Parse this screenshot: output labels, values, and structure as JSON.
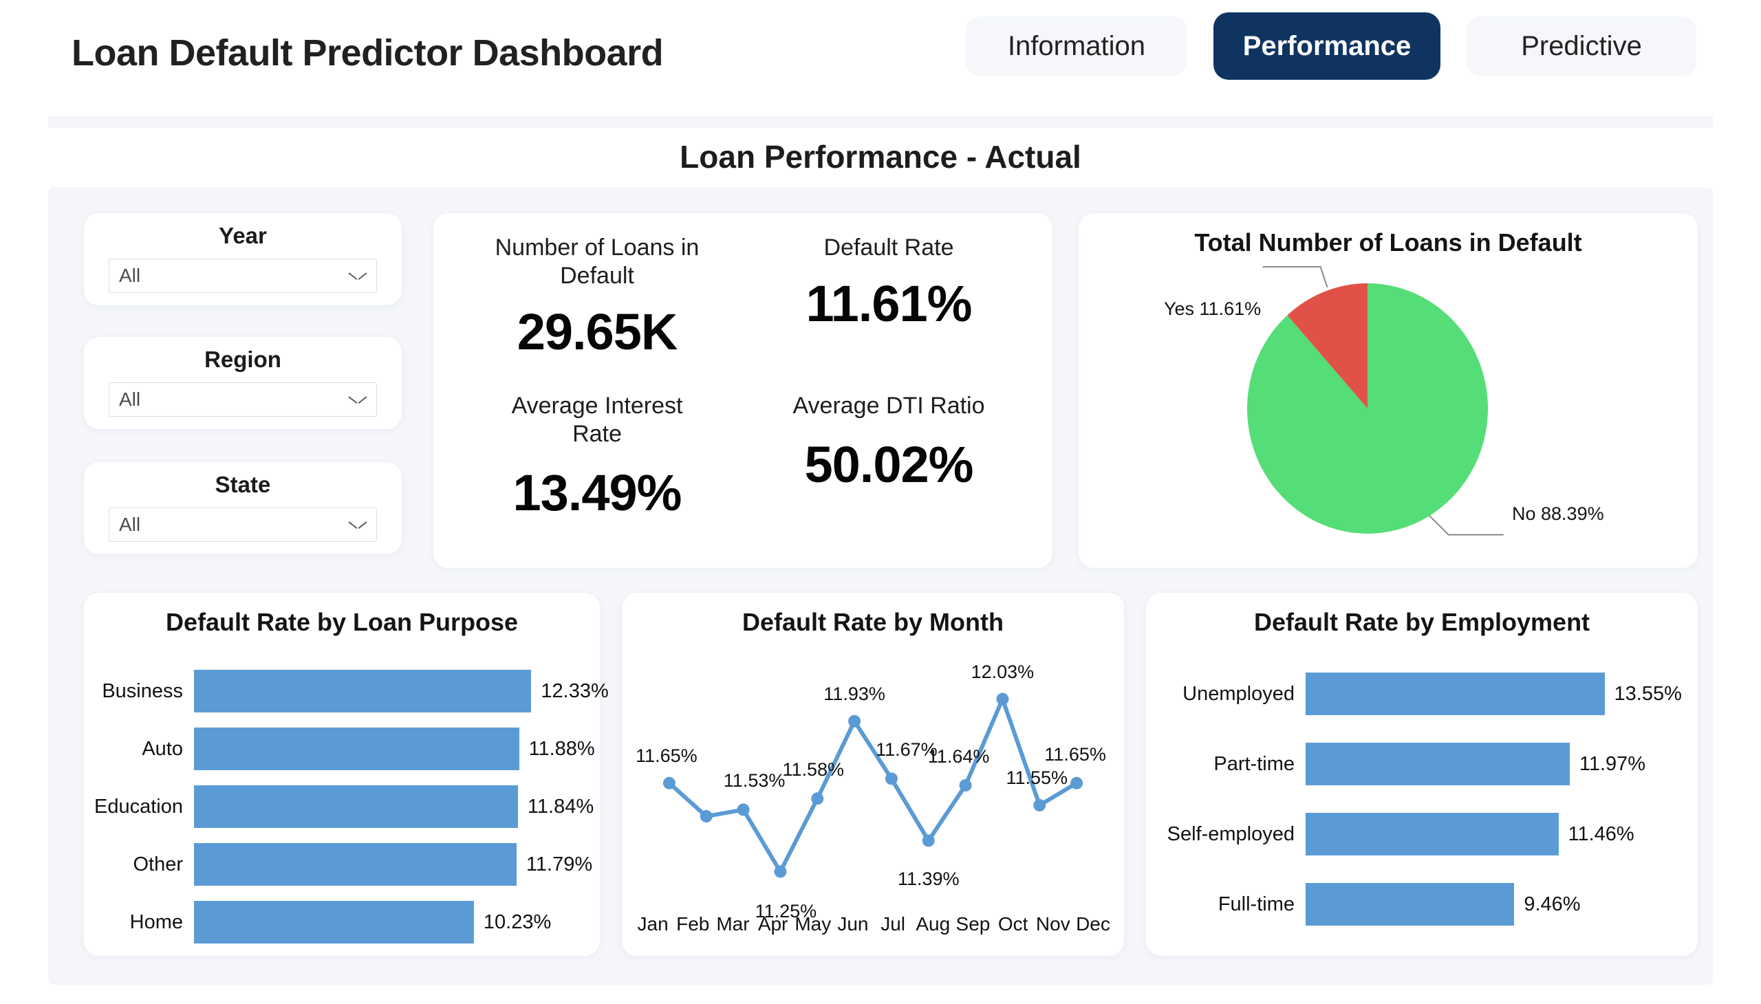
{
  "header": {
    "app_title": "Loan Default Predictor Dashboard",
    "tabs": [
      {
        "label": "Information",
        "active": false
      },
      {
        "label": "Performance",
        "active": true
      },
      {
        "label": "Predictive",
        "active": false
      }
    ],
    "section_title": "Loan Performance - Actual"
  },
  "filters": [
    {
      "label": "Year",
      "value": "All",
      "icon": "chevron-down-icon"
    },
    {
      "label": "Region",
      "value": "All",
      "icon": "chevron-down-icon"
    },
    {
      "label": "State",
      "value": "All",
      "icon": "chevron-down-icon"
    }
  ],
  "kpis": [
    {
      "label": "Number of Loans in Default",
      "value": "29.65K"
    },
    {
      "label": "Default Rate",
      "value": "11.61%"
    },
    {
      "label": "Average Interest Rate",
      "value": "13.49%"
    },
    {
      "label": "Average DTI Ratio",
      "value": "50.02%"
    }
  ],
  "colors": {
    "accent_navy": "#0f3460",
    "bar_blue": "#5b9bd5",
    "pie_green": "#55dd77",
    "pie_red": "#e05247",
    "page_bg": "#f4f6fa"
  },
  "chart_data": [
    {
      "type": "pie",
      "title": "Total Number of Loans in Default",
      "categories": [
        "Yes",
        "No"
      ],
      "values": [
        11.61,
        88.39
      ],
      "labels": [
        "Yes 11.61%",
        "No 88.39%"
      ],
      "colors": [
        "#e05247",
        "#55dd77"
      ],
      "legend": "callout-labels",
      "units": "percent"
    },
    {
      "type": "bar",
      "orientation": "horizontal",
      "title": "Default Rate by Loan Purpose",
      "categories": [
        "Business",
        "Auto",
        "Education",
        "Other",
        "Home"
      ],
      "values": [
        12.33,
        11.88,
        11.84,
        11.79,
        10.23
      ],
      "value_labels": [
        "12.33%",
        "11.88%",
        "11.84%",
        "11.79%",
        "10.23%"
      ],
      "xlabel": "",
      "ylabel": "",
      "xlim": [
        0,
        13.2
      ],
      "grid": false,
      "color": "#5b9bd5"
    },
    {
      "type": "line",
      "title": "Default Rate by Month",
      "x": [
        "Jan",
        "Feb",
        "Mar",
        "Apr",
        "May",
        "Jun",
        "Jul",
        "Aug",
        "Sep",
        "Oct",
        "Nov",
        "Dec"
      ],
      "values": [
        11.65,
        11.5,
        11.53,
        11.25,
        11.58,
        11.93,
        11.67,
        11.39,
        11.64,
        12.03,
        11.55,
        11.65
      ],
      "value_labels": [
        "11.65%",
        "",
        "11.53%",
        "11.25%",
        "11.58%",
        "11.93%",
        "11.67%",
        "11.39%",
        "11.64%",
        "12.03%",
        "11.55%",
        "11.65%"
      ],
      "ylim": [
        11.18,
        12.1
      ],
      "xlabel": "",
      "ylabel": "",
      "grid": false,
      "color": "#5b9bd5",
      "markers": true
    },
    {
      "type": "bar",
      "orientation": "horizontal",
      "title": "Default Rate by Employment",
      "categories": [
        "Unemployed",
        "Part-time",
        "Self-employed",
        "Full-time"
      ],
      "values": [
        13.55,
        11.97,
        11.46,
        9.46
      ],
      "value_labels": [
        "13.55%",
        "11.97%",
        "11.46%",
        "9.46%"
      ],
      "xlabel": "",
      "ylabel": "",
      "xlim": [
        0,
        14.5
      ],
      "grid": false,
      "color": "#5b9bd5"
    }
  ]
}
